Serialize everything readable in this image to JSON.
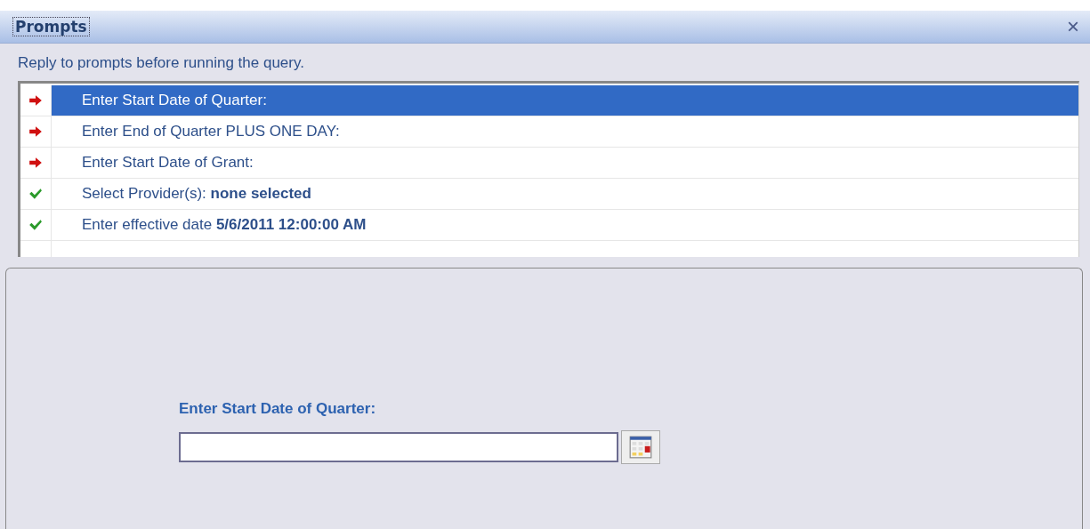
{
  "window": {
    "title": "Prompts",
    "close": "×"
  },
  "instruction": "Reply to prompts before running the query.",
  "prompts": [
    {
      "kind": "pending",
      "selected": true,
      "text": "Enter Start Date of Quarter:"
    },
    {
      "kind": "pending",
      "selected": false,
      "text": "Enter End of Quarter PLUS ONE DAY:"
    },
    {
      "kind": "pending",
      "selected": false,
      "text": "Enter Start Date of Grant:"
    },
    {
      "kind": "done",
      "selected": false,
      "text": "Select Provider(s): **none selected**"
    },
    {
      "kind": "done",
      "selected": false,
      "text": "Enter effective date **5/6/2011 12:00:00 AM**"
    }
  ],
  "editor": {
    "label": "Enter Start Date of Quarter:"
  }
}
